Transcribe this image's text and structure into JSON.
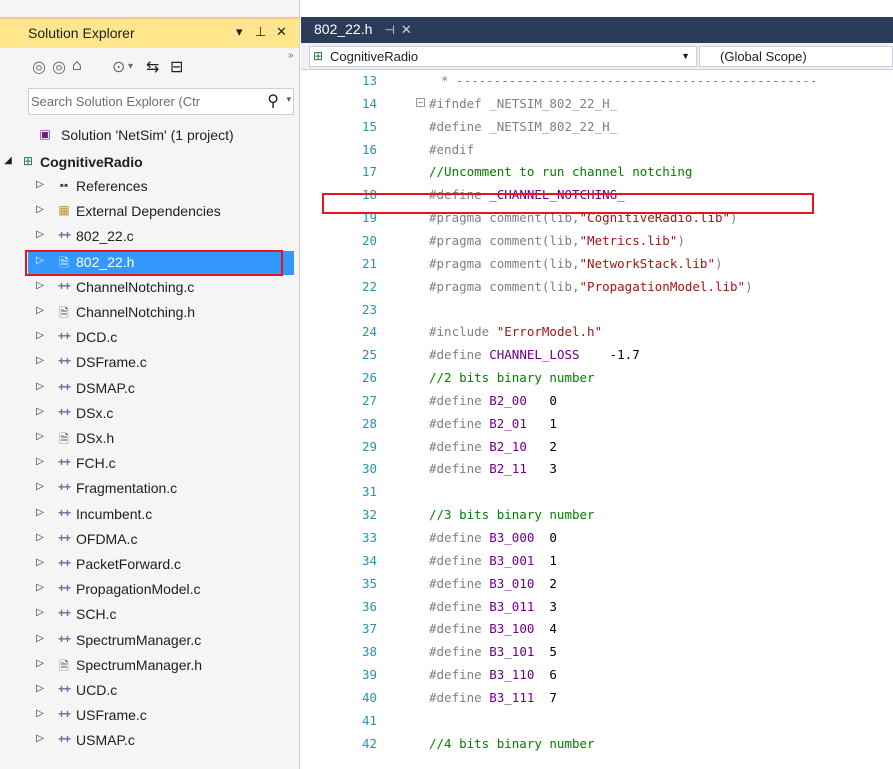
{
  "solution_explorer": {
    "title": "Solution Explorer",
    "title_buttons": [
      "▾",
      "⊥",
      "✕"
    ],
    "search_placeholder": "Search Solution Explorer (Ctr",
    "solution": "Solution 'NetSim' (1 project)",
    "project": "CognitiveRadio",
    "items": [
      {
        "label": "References",
        "icon": "references-icon"
      },
      {
        "label": "External Dependencies",
        "icon": "external-dependencies-icon"
      },
      {
        "label": "802_22.c",
        "icon": "c-file-icon"
      },
      {
        "label": "802_22.h",
        "icon": "h-file-icon",
        "selected": true
      },
      {
        "label": "ChannelNotching.c",
        "icon": "c-file-icon"
      },
      {
        "label": "ChannelNotching.h",
        "icon": "h-file-icon"
      },
      {
        "label": "DCD.c",
        "icon": "c-file-icon"
      },
      {
        "label": "DSFrame.c",
        "icon": "c-file-icon"
      },
      {
        "label": "DSMAP.c",
        "icon": "c-file-icon"
      },
      {
        "label": "DSx.c",
        "icon": "c-file-icon"
      },
      {
        "label": "DSx.h",
        "icon": "h-file-icon"
      },
      {
        "label": "FCH.c",
        "icon": "c-file-icon"
      },
      {
        "label": "Fragmentation.c",
        "icon": "c-file-icon"
      },
      {
        "label": "Incumbent.c",
        "icon": "c-file-icon"
      },
      {
        "label": "OFDMA.c",
        "icon": "c-file-icon"
      },
      {
        "label": "PacketForward.c",
        "icon": "c-file-icon"
      },
      {
        "label": "PropagationModel.c",
        "icon": "c-file-icon"
      },
      {
        "label": "SCH.c",
        "icon": "c-file-icon"
      },
      {
        "label": "SpectrumManager.c",
        "icon": "c-file-icon"
      },
      {
        "label": "SpectrumManager.h",
        "icon": "h-file-icon"
      },
      {
        "label": "UCD.c",
        "icon": "c-file-icon"
      },
      {
        "label": "USFrame.c",
        "icon": "c-file-icon"
      },
      {
        "label": "USMAP.c",
        "icon": "c-file-icon"
      }
    ]
  },
  "editor": {
    "tab_label": "802_22.h",
    "project_dropdown": "CognitiveRadio",
    "scope_dropdown": "(Global Scope)",
    "lines": [
      {
        "n": "13",
        "t": "* ------------------------------------------------",
        "k": "pp",
        "indent": 1
      },
      {
        "n": "14",
        "t": "#ifndef _NETSIM_802_22_H_",
        "k": "pp",
        "fold": true
      },
      {
        "n": "15",
        "t": "#define _NETSIM_802_22_H_",
        "k": "pp"
      },
      {
        "n": "16",
        "t": "#endif",
        "k": "pp"
      },
      {
        "n": "17",
        "t": "//Uncomment to run channel notching",
        "k": "cmt"
      },
      {
        "n": "18",
        "t": "#define _CHANNEL_NOTCHING_",
        "k": "define",
        "name": "_CHANNEL_NOTCHING_",
        "val": ""
      },
      {
        "n": "19",
        "t": "#pragma comment(lib,\"CognitiveRadio.lib\")",
        "k": "pragma",
        "lib": "\"CognitiveRadio.lib\""
      },
      {
        "n": "20",
        "t": "#pragma comment(lib,\"Metrics.lib\")",
        "k": "pragma",
        "lib": "\"Metrics.lib\""
      },
      {
        "n": "21",
        "t": "#pragma comment(lib,\"NetworkStack.lib\")",
        "k": "pragma",
        "lib": "\"NetworkStack.lib\""
      },
      {
        "n": "22",
        "t": "#pragma comment(lib,\"PropagationModel.lib\")",
        "k": "pragma",
        "lib": "\"PropagationModel.lib\""
      },
      {
        "n": "23",
        "t": "",
        "k": "blank"
      },
      {
        "n": "24",
        "t": "#include \"ErrorModel.h\"",
        "k": "include",
        "lib": "\"ErrorModel.h\""
      },
      {
        "n": "25",
        "t": "#define CHANNEL_LOSS    -1.7",
        "k": "define",
        "name": "CHANNEL_LOSS",
        "val": "    -1.7"
      },
      {
        "n": "26",
        "t": "//2 bits binary number",
        "k": "cmt"
      },
      {
        "n": "27",
        "t": "#define B2_00   0",
        "k": "define",
        "name": "B2_00",
        "val": "   0"
      },
      {
        "n": "28",
        "t": "#define B2_01   1",
        "k": "define",
        "name": "B2_01",
        "val": "   1"
      },
      {
        "n": "29",
        "t": "#define B2_10   2",
        "k": "define",
        "name": "B2_10",
        "val": "   2"
      },
      {
        "n": "30",
        "t": "#define B2_11   3",
        "k": "define",
        "name": "B2_11",
        "val": "   3"
      },
      {
        "n": "31",
        "t": "",
        "k": "blank"
      },
      {
        "n": "32",
        "t": "//3 bits binary number",
        "k": "cmt"
      },
      {
        "n": "33",
        "t": "#define B3_000  0",
        "k": "define",
        "name": "B3_000",
        "val": "  0"
      },
      {
        "n": "34",
        "t": "#define B3_001  1",
        "k": "define",
        "name": "B3_001",
        "val": "  1"
      },
      {
        "n": "35",
        "t": "#define B3_010  2",
        "k": "define",
        "name": "B3_010",
        "val": "  2"
      },
      {
        "n": "36",
        "t": "#define B3_011  3",
        "k": "define",
        "name": "B3_011",
        "val": "  3"
      },
      {
        "n": "37",
        "t": "#define B3_100  4",
        "k": "define",
        "name": "B3_100",
        "val": "  4"
      },
      {
        "n": "38",
        "t": "#define B3_101  5",
        "k": "define",
        "name": "B3_101",
        "val": "  5"
      },
      {
        "n": "39",
        "t": "#define B3_110  6",
        "k": "define",
        "name": "B3_110",
        "val": "  6"
      },
      {
        "n": "40",
        "t": "#define B3_111  7",
        "k": "define",
        "name": "B3_111",
        "val": "  7"
      },
      {
        "n": "41",
        "t": "",
        "k": "blank"
      },
      {
        "n": "42",
        "t": "//4 bits binary number",
        "k": "cmt"
      }
    ]
  },
  "colors": {
    "selection": "#3399ff",
    "title_active": "#ffe58c",
    "tab_bar": "#2b3c59",
    "highlight_box": "#e8141b"
  }
}
